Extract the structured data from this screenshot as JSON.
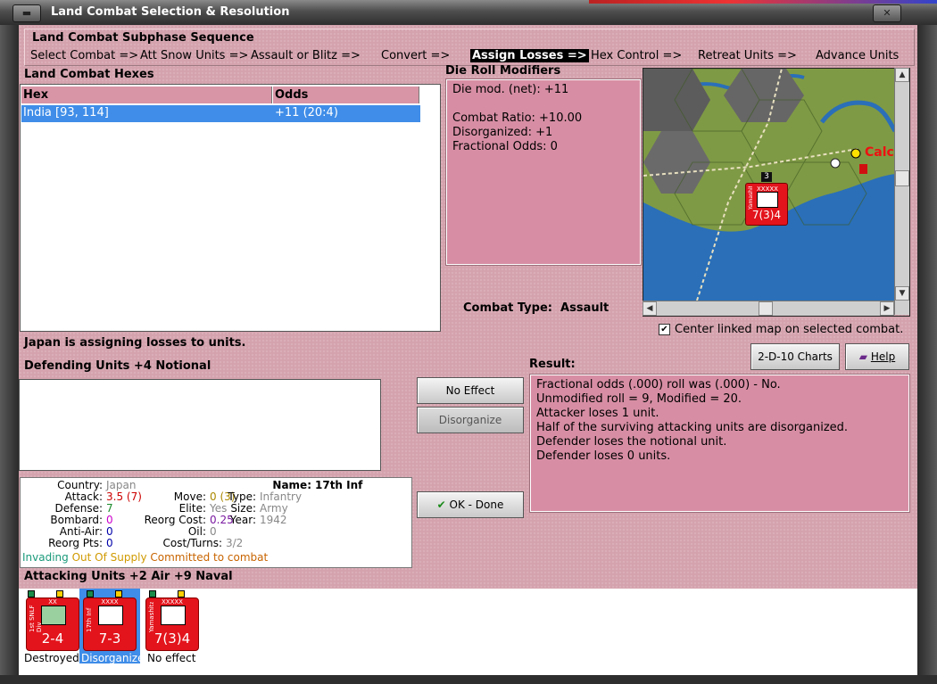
{
  "window": {
    "title": "Land Combat Selection & Resolution"
  },
  "sequence": {
    "title": "Land Combat Subphase Sequence",
    "steps": [
      {
        "label": "Select Combat =>",
        "active": false
      },
      {
        "label": "Att Snow Units =>",
        "active": false
      },
      {
        "label": "Assault or Blitz =>",
        "active": false
      },
      {
        "label": "Convert =>",
        "active": false
      },
      {
        "label": "Assign Losses =>",
        "active": true
      },
      {
        "label": "Hex Control =>",
        "active": false
      },
      {
        "label": "Retreat Units =>",
        "active": false
      },
      {
        "label": "Advance Units",
        "active": false
      }
    ]
  },
  "hexes": {
    "title": "Land Combat Hexes",
    "columns": [
      "Hex",
      "Odds"
    ],
    "rows": [
      {
        "hex": "India [93, 114]",
        "odds": "+11 (20:4)"
      }
    ]
  },
  "die_roll": {
    "title": "Die Roll Modifiers",
    "lines": [
      "Die mod. (net): +11",
      "",
      "Combat Ratio: +10.00",
      "Disorganized: +1",
      "Fractional Odds: 0"
    ]
  },
  "combat_type": {
    "label": "Combat Type:",
    "value": "Assault"
  },
  "map": {
    "city_label": "Calc",
    "stack_count": "3",
    "counter_strength": "7(3)4",
    "counter_size": "XXXXX",
    "counter_name": "Yamashita",
    "colors": {
      "sea": "#2a6fb8",
      "forest": "#7f9a45",
      "hill": "#5c5c5c",
      "counter": "#e3141c"
    }
  },
  "center_map": {
    "label": "Center linked map on selected combat.",
    "checked": true
  },
  "status_message": "Japan is assigning losses to units.",
  "buttons": {
    "charts": "2-D-10 Charts",
    "help": "Help",
    "no_effect": "No Effect",
    "disorganize": "Disorganize",
    "ok_done": "OK - Done"
  },
  "defending": {
    "title": "Defending Units +4 Notional"
  },
  "unit_info": {
    "country_k": "Country:",
    "country_v": "Japan",
    "attack_k": "Attack:",
    "attack_v": "3.5",
    "attack_v2": "(7)",
    "defense_k": "Defense:",
    "defense_v": "7",
    "bombard_k": "Bombard:",
    "bombard_v": "0",
    "antiair_k": "Anti-Air:",
    "antiair_v": "0",
    "reorgpts_k": "Reorg Pts:",
    "reorgpts_v": "0",
    "move_k": "Move:",
    "move_v": "0",
    "move_v2": "(3)",
    "elite_k": "Elite:",
    "elite_v": "Yes",
    "reorgcost_k": "Reorg Cost:",
    "reorgcost_v": "0.25",
    "oil_k": "Oil:",
    "oil_v": "0",
    "costturns_k": "Cost/Turns:",
    "costturns_v": "3/2",
    "name_k": "Name:",
    "name_v": "17th Inf",
    "type_k": "Type:",
    "type_v": "Infantry",
    "size_k": "Size:",
    "size_v": "Army",
    "year_k": "Year:",
    "year_v": "1942",
    "status1": "Invading",
    "status2": "Out Of Supply",
    "status3": "Committed to combat"
  },
  "result": {
    "title": "Result:",
    "lines": [
      "Fractional odds (.000) roll was (.000)  - No.",
      "Unmodified roll = 9, Modified = 20.",
      "Attacker loses 1 unit.",
      "Half of the surviving attacking units are disorganized.",
      "Defender loses the notional unit.",
      "Defender loses 0 units."
    ]
  },
  "attacking": {
    "title": "Attacking Units +2 Air +9 Naval",
    "units": [
      {
        "name": "1st SNLF Div",
        "size": "XX",
        "strength": "2-4",
        "status": "Destroyed",
        "selected": false
      },
      {
        "name": "17th Inf",
        "size": "XXXX",
        "strength": "7-3",
        "status": "Disorganized",
        "selected": true
      },
      {
        "name": "Yamashita",
        "size": "XXXXX",
        "strength": "7(3)4",
        "status": "No effect",
        "selected": false
      }
    ]
  }
}
